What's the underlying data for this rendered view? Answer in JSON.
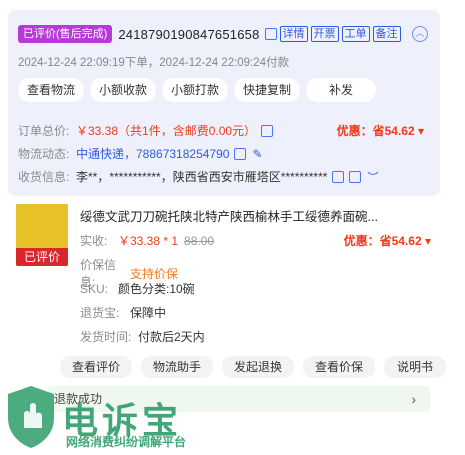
{
  "order": {
    "status_badge": "已评价(售后完成)",
    "order_no": "2418790190847651658",
    "chips": [
      "详情",
      "开票",
      "工单",
      "备注"
    ],
    "time_text": "2024-12-24 22:09:19下单，2024-12-24 22:09:24付款",
    "buttons": [
      "查看物流",
      "小额收款",
      "小额打款",
      "快捷复制",
      "补发"
    ],
    "total_label": "订单总价:",
    "total_value": "￥33.38（共1件，含邮费0.00元）",
    "discount": "优惠：省54.62",
    "logistics_label": "物流动态:",
    "logistics_value": "中通快递，78867318254790",
    "receiver_label": "收货信息:",
    "receiver_value": "李**，***********，陕西省西安市雁塔区**********"
  },
  "product": {
    "image_label": "已评价",
    "title": "绥德文武刀刀碗托陕北特产陕西榆林手工绥德养面碗...",
    "paid_label": "实收:",
    "paid_value": "￥33.38 * 1",
    "original_price": "88.00",
    "discount": "优惠：省54.62",
    "insured_label": "价保信息:",
    "insured_value": "支持价保",
    "sku_label": "SKU:",
    "sku_value": "颜色分类:10碗",
    "return_label": "退货宝:",
    "return_value": "保障中",
    "ship_label": "发货时间:",
    "ship_value": "付款后2天内",
    "actions": [
      "查看评价",
      "物流助手",
      "发起退换",
      "查看价保",
      "说明书"
    ],
    "refund_text": "退款成功"
  },
  "watermark": {
    "title": "电诉宝",
    "subtitle": "网络消费纠纷调解平台"
  },
  "colors": {
    "accent": "#2f5be0",
    "badge": "#b53ad6",
    "price": "#f23a19",
    "watermark": "#2d9e6a"
  }
}
